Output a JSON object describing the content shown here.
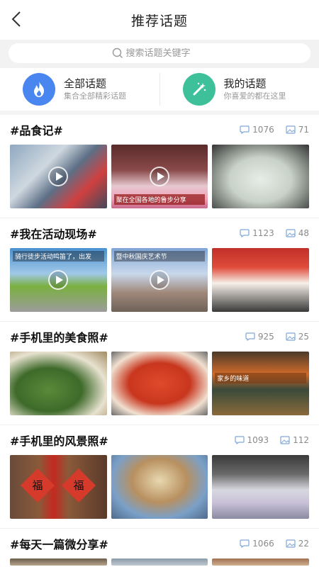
{
  "header": {
    "title": "推荐话题",
    "back_icon": "chevron-left-icon"
  },
  "search": {
    "placeholder": "搜索话题关键字",
    "icon": "search-icon"
  },
  "entries": [
    {
      "title": "全部话题",
      "subtitle": "集合全部精彩话题",
      "icon": "flame-icon",
      "color": "#4a86f0"
    },
    {
      "title": "我的话题",
      "subtitle": "你喜爱的都在这里",
      "icon": "magic-wand-icon",
      "color": "#3ec19a"
    }
  ],
  "topics": [
    {
      "title": "#品食记#",
      "comments": "1076",
      "posts": "71",
      "thumbs": [
        {
          "caption": "",
          "video": true
        },
        {
          "caption": "聚在全国各地的鲁步分享",
          "video": true
        },
        {
          "caption": "",
          "video": false
        }
      ]
    },
    {
      "title": "#我在活动现场#",
      "comments": "1123",
      "posts": "48",
      "thumbs": [
        {
          "caption": "骑行徒步活动鸣笛了，出发",
          "video": true
        },
        {
          "caption": "暨中秋国庆艺术节",
          "video": true
        },
        {
          "caption": "",
          "video": false
        }
      ]
    },
    {
      "title": "#手机里的美食照#",
      "comments": "925",
      "posts": "25",
      "thumbs": [
        {
          "caption": "",
          "video": false
        },
        {
          "caption": "",
          "video": false
        },
        {
          "caption": "家乡的味道",
          "video": false
        }
      ]
    },
    {
      "title": "#手机里的风景照#",
      "comments": "1093",
      "posts": "112",
      "thumbs": [
        {
          "caption": "",
          "video": false,
          "door_text": "福"
        },
        {
          "caption": "",
          "video": false
        },
        {
          "caption": "",
          "video": false
        }
      ]
    },
    {
      "title": "#每天一篇微分享#",
      "comments": "1066",
      "posts": "22",
      "thumbs": []
    }
  ]
}
